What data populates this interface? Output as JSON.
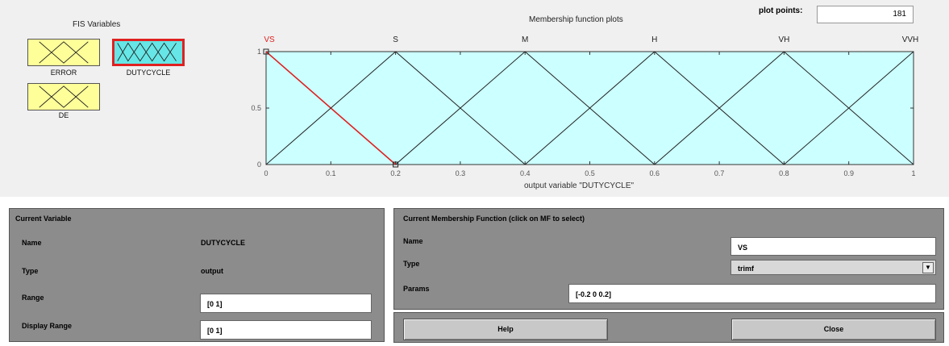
{
  "fis": {
    "title": "FIS Variables",
    "variables": [
      {
        "label": "ERROR",
        "selected": false,
        "color": "#ffff99"
      },
      {
        "label": "DUTYCYCLE",
        "selected": true,
        "color": "#66e6e6"
      },
      {
        "label": "DE",
        "selected": false,
        "color": "#ffff99"
      }
    ],
    "highlight_color": "#e02020"
  },
  "plot": {
    "title": "Membership function plots",
    "plot_points_label": "plot points:",
    "plot_points_value": "181",
    "xlabel": "output variable \"DUTYCYCLE\"",
    "background": "#ccffff",
    "selected_color": "#e02020"
  },
  "chart_data": {
    "type": "line",
    "title": "Membership function plots",
    "xlabel": "output variable \"DUTYCYCLE\"",
    "ylabel": "",
    "xlim": [
      0,
      1
    ],
    "ylim": [
      0,
      1
    ],
    "x_ticks": [
      "0",
      "0.1",
      "0.2",
      "0.3",
      "0.4",
      "0.5",
      "0.6",
      "0.7",
      "0.8",
      "0.9",
      "1"
    ],
    "y_ticks": [
      "0",
      "0.5",
      "1"
    ],
    "series": [
      {
        "name": "VS",
        "selected": true,
        "points": [
          [
            -0.2,
            0
          ],
          [
            0,
            1
          ],
          [
            0.2,
            0
          ]
        ]
      },
      {
        "name": "S",
        "selected": false,
        "points": [
          [
            0,
            0
          ],
          [
            0.2,
            1
          ],
          [
            0.4,
            0
          ]
        ]
      },
      {
        "name": "M",
        "selected": false,
        "points": [
          [
            0.2,
            0
          ],
          [
            0.4,
            1
          ],
          [
            0.6,
            0
          ]
        ]
      },
      {
        "name": "H",
        "selected": false,
        "points": [
          [
            0.4,
            0
          ],
          [
            0.6,
            1
          ],
          [
            0.8,
            0
          ]
        ]
      },
      {
        "name": "VH",
        "selected": false,
        "points": [
          [
            0.6,
            0
          ],
          [
            0.8,
            1
          ],
          [
            1.0,
            0
          ]
        ]
      },
      {
        "name": "VVH",
        "selected": false,
        "points": [
          [
            0.8,
            0
          ],
          [
            1.0,
            1
          ],
          [
            1.2,
            0
          ]
        ]
      }
    ]
  },
  "current_variable": {
    "title": "Current Variable",
    "name_label": "Name",
    "name_value": "DUTYCYCLE",
    "type_label": "Type",
    "type_value": "output",
    "range_label": "Range",
    "range_value": "[0 1]",
    "display_range_label": "Display Range",
    "display_range_value": "[0 1]"
  },
  "current_mf": {
    "title": "Current Membership Function (click on MF to select)",
    "name_label": "Name",
    "name_value": "VS",
    "type_label": "Type",
    "type_value": "trimf",
    "params_label": "Params",
    "params_value": "[-0.2 0 0.2]"
  },
  "buttons": {
    "help": "Help",
    "close": "Close"
  }
}
